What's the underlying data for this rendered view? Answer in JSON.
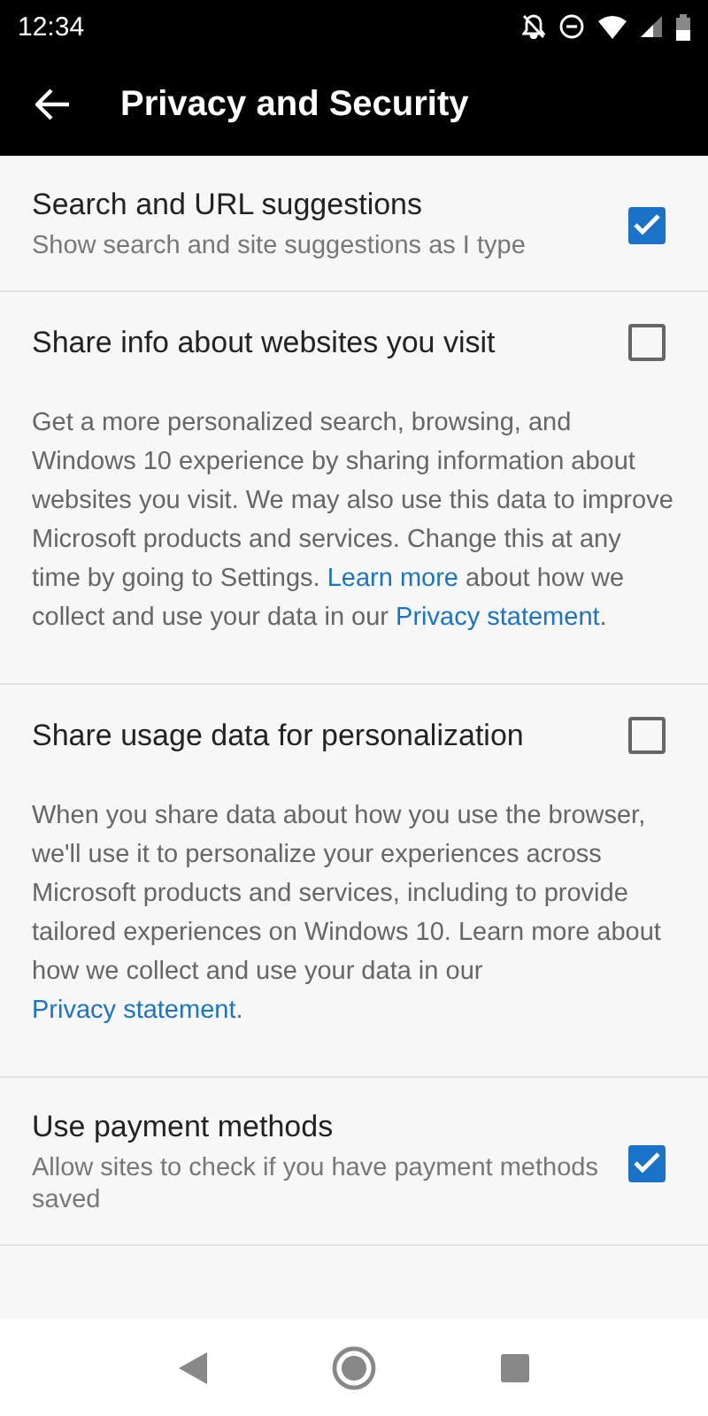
{
  "status_bar": {
    "time": "12:34"
  },
  "toolbar": {
    "title": "Privacy and Security"
  },
  "settings": [
    {
      "title": "Search and URL suggestions",
      "subtitle": "Show search and site suggestions as I type",
      "checked": true
    },
    {
      "title": "Share info about websites you visit",
      "checked": false,
      "paragraph": [
        {
          "kind": "text",
          "text": "Get a more personalized search, browsing, and Windows 10 experience by sharing information about websites you visit. We may also use this data to improve Microsoft products and services. Change this at any time by going to Settings. "
        },
        {
          "kind": "link",
          "text": "Learn more"
        },
        {
          "kind": "text",
          "text": " about how we collect and use your data in our "
        },
        {
          "kind": "link",
          "text": "Privacy statement"
        },
        {
          "kind": "text",
          "text": "."
        }
      ]
    },
    {
      "title": "Share usage data for personalization",
      "checked": false,
      "paragraph": [
        {
          "kind": "text",
          "text": "When you share data about how you use the browser, we'll use it to personalize your experiences across Microsoft products and services, including to provide tailored experiences on Windows 10. Learn more about how we collect and use your data in our "
        },
        {
          "kind": "link",
          "text": "Privacy statement"
        },
        {
          "kind": "text",
          "text": "."
        }
      ]
    },
    {
      "title": "Use payment methods",
      "subtitle": "Allow sites to check if you have payment methods saved",
      "checked": true
    }
  ]
}
